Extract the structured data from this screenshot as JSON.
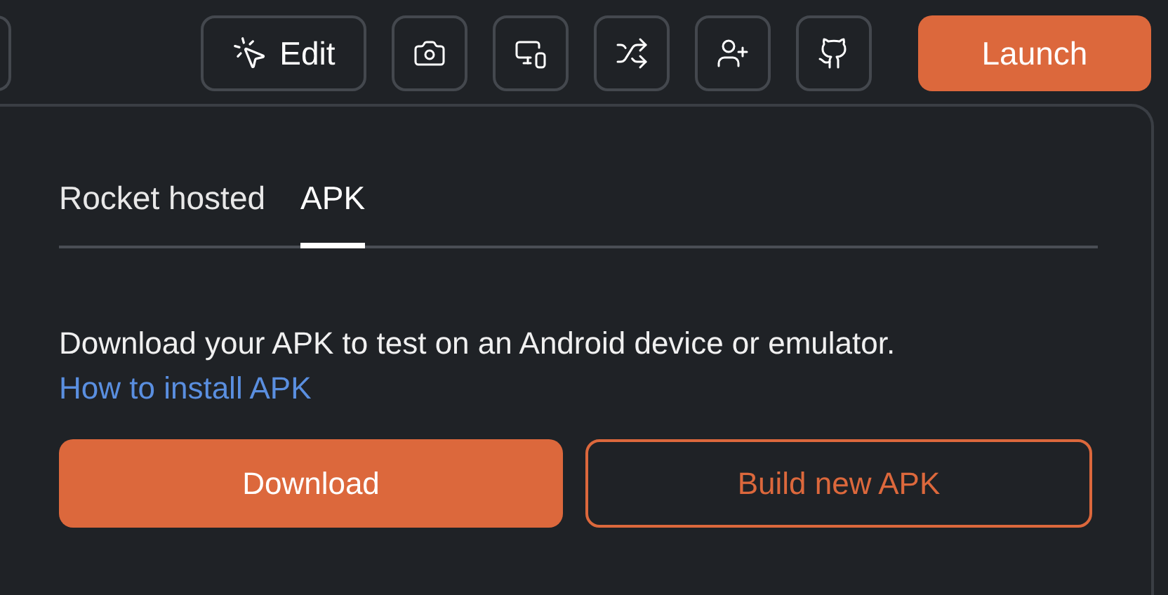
{
  "toolbar": {
    "edit_label": "Edit",
    "buttons": [
      {
        "kind": "camera"
      },
      {
        "kind": "devices"
      },
      {
        "kind": "shuffle"
      },
      {
        "kind": "add-user"
      },
      {
        "kind": "github"
      }
    ],
    "launch": "Launch"
  },
  "panel": {
    "tabs": [
      {
        "label": "Rocket hosted",
        "selected": false
      },
      {
        "label": "APK",
        "selected": true
      }
    ],
    "description": "Download your APK to test on an Android device or emulator.",
    "link": "How to install APK",
    "primary_button": "Download",
    "secondary_button": "Build new APK"
  }
}
